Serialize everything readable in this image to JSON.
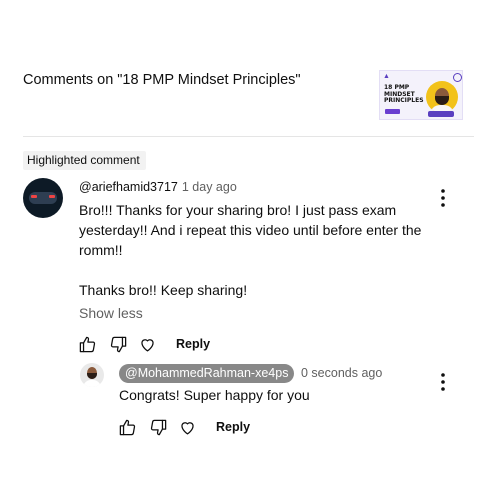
{
  "header": {
    "title": "Comments on \"18 PMP Mindset Principles\"",
    "thumbnail": {
      "title_lines": "18 PMP\nMINDSET\nPRINCIPLES",
      "icon": "video-thumbnail"
    }
  },
  "highlighted_label": "Highlighted comment",
  "comment": {
    "author": "@ariefhamid3717",
    "time": "1 day ago",
    "paragraph1": "Bro!!! Thanks for your sharing bro! I just pass exam yesterday!! And i repeat this video until before enter the romm!!",
    "paragraph2": "Thanks bro!! Keep sharing!",
    "show_less": "Show less",
    "reply_label": "Reply"
  },
  "reply": {
    "author": "@MohammedRahman-xe4ps",
    "time": "0 seconds ago",
    "text": "Congrats! Super happy for you",
    "reply_label": "Reply"
  },
  "icons": [
    "like-icon",
    "dislike-icon",
    "heart-icon",
    "more-vert-icon"
  ]
}
